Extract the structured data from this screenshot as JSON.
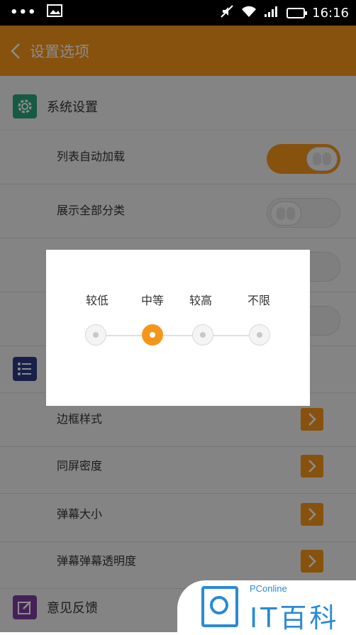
{
  "status_bar": {
    "dots": "•••",
    "time": "16:16"
  },
  "header": {
    "title": "设置选项"
  },
  "sections": {
    "system": {
      "label": "系统设置"
    },
    "feedback": {
      "label": "意见反馈"
    }
  },
  "rows": {
    "auto_load": {
      "label": "列表自动加载",
      "on": true
    },
    "show_all": {
      "label": "展示全部分类",
      "on": false
    },
    "border_style": {
      "label": "边框样式"
    },
    "density": {
      "label": "同屏密度"
    },
    "danmaku_size": {
      "label": "弹幕大小"
    },
    "danmaku_opacity": {
      "label": "弹幕弹幕透明度"
    }
  },
  "dialog": {
    "levels": [
      "较低",
      "中等",
      "较高",
      "不限"
    ],
    "selected": 1
  },
  "watermark": {
    "small": "PConline",
    "big": "IT百科"
  },
  "colors": {
    "accent": "#f5961b",
    "system_icon": "#2aa57a",
    "list_icon": "#2c3b86",
    "feedback_icon": "#7a3fa0"
  }
}
